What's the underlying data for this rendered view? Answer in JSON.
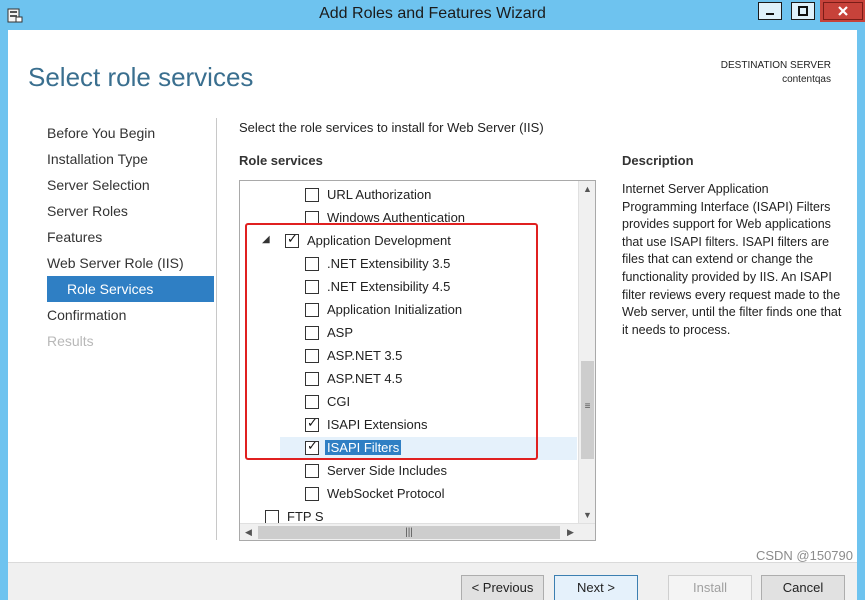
{
  "window": {
    "title": "Add Roles and Features Wizard",
    "icon": "server-manager-icon",
    "controls": {
      "minimize": "minimize-icon",
      "maximize": "maximize-icon",
      "close": "close-icon"
    }
  },
  "header": {
    "page_title": "Select role services",
    "destination_label": "DESTINATION SERVER",
    "destination_value": "contentqas"
  },
  "nav": {
    "items": [
      {
        "label": "Before You Begin",
        "state": "normal"
      },
      {
        "label": "Installation Type",
        "state": "normal"
      },
      {
        "label": "Server Selection",
        "state": "normal"
      },
      {
        "label": "Server Roles",
        "state": "normal"
      },
      {
        "label": "Features",
        "state": "normal"
      },
      {
        "label": "Web Server Role (IIS)",
        "state": "normal"
      },
      {
        "label": "Role Services",
        "state": "active"
      },
      {
        "label": "Confirmation",
        "state": "normal"
      },
      {
        "label": "Results",
        "state": "disabled"
      }
    ]
  },
  "main": {
    "instruction": "Select the role services to install for Web Server (IIS)",
    "role_services_label": "Role services",
    "tree": [
      {
        "label": "URL Authorization",
        "checked": false,
        "level": 2
      },
      {
        "label": "Windows Authentication",
        "checked": false,
        "level": 2
      },
      {
        "label": "Application Development",
        "checked": true,
        "level": 1,
        "expanded": true
      },
      {
        "label": ".NET Extensibility 3.5",
        "checked": false,
        "level": 2
      },
      {
        "label": ".NET Extensibility 4.5",
        "checked": false,
        "level": 2
      },
      {
        "label": "Application Initialization",
        "checked": false,
        "level": 2
      },
      {
        "label": "ASP",
        "checked": false,
        "level": 2
      },
      {
        "label": "ASP.NET 3.5",
        "checked": false,
        "level": 2
      },
      {
        "label": "ASP.NET 4.5",
        "checked": false,
        "level": 2
      },
      {
        "label": "CGI",
        "checked": false,
        "level": 2
      },
      {
        "label": "ISAPI Extensions",
        "checked": true,
        "level": 2
      },
      {
        "label": "ISAPI Filters",
        "checked": true,
        "level": 2,
        "selected": true
      },
      {
        "label": "Server Side Includes",
        "checked": false,
        "level": 2
      },
      {
        "label": "WebSocket Protocol",
        "checked": false,
        "level": 2
      },
      {
        "label": "FTP S",
        "checked": false,
        "level": 1,
        "partial": true
      }
    ]
  },
  "description": {
    "label": "Description",
    "text": "Internet Server Application Programming Interface (ISAPI) Filters provides support for Web applications that use ISAPI filters. ISAPI filters are files that can extend or change the functionality provided by IIS. An ISAPI filter reviews every request made to the Web server, until the filter finds one that it needs to process."
  },
  "footer": {
    "previous": "< Previous",
    "next": "Next >",
    "install": "Install",
    "cancel": "Cancel",
    "watermark": "CSDN @150790"
  },
  "colors": {
    "title_bar": "#6ec3ef",
    "accent": "#2f7fc4",
    "heading": "#3a6f8f",
    "annotation_box": "#e02020"
  }
}
